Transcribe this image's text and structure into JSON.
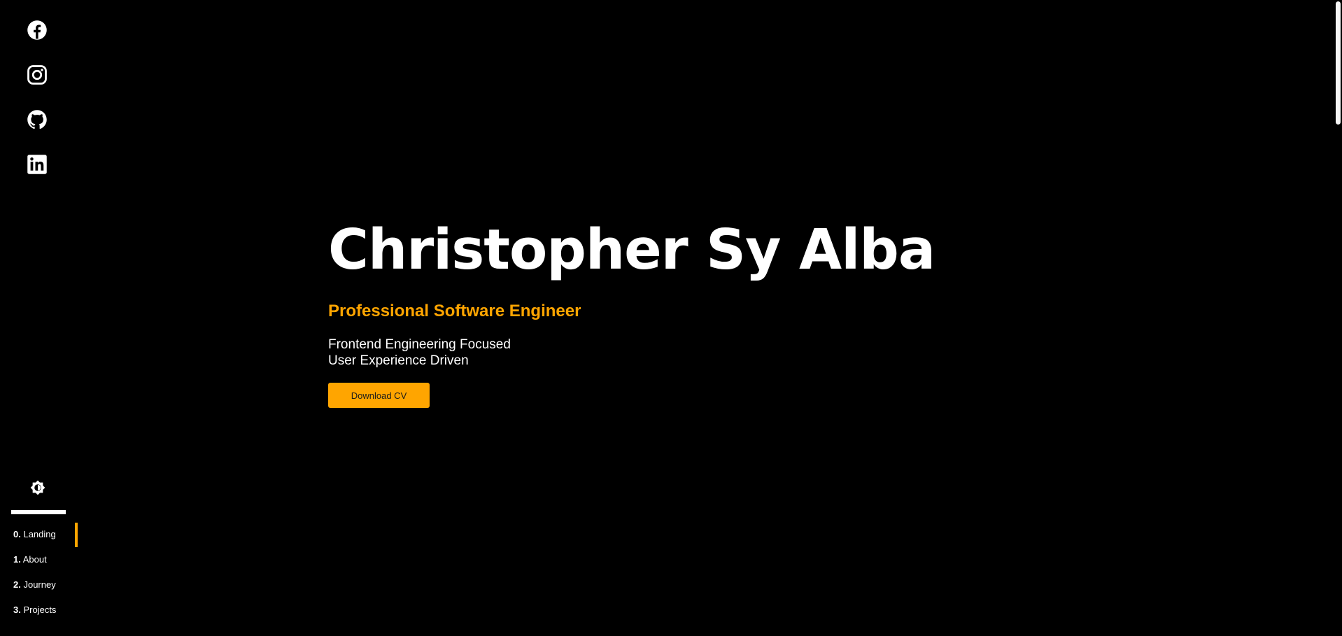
{
  "hero": {
    "name": "Christopher Sy Alba",
    "title": "Professional Software Engineer",
    "tagline_line1": "Frontend Engineering Focused",
    "tagline_line2": "User Experience Driven",
    "cv_button_label": "Download CV"
  },
  "social": {
    "icons": [
      "facebook-icon",
      "instagram-icon",
      "github-icon",
      "linkedin-icon"
    ]
  },
  "theme_toggle": {
    "icon": "brightness-icon"
  },
  "nav": {
    "items": [
      {
        "num": "0.",
        "label": "Landing"
      },
      {
        "num": "1.",
        "label": "About"
      },
      {
        "num": "2.",
        "label": "Journey"
      },
      {
        "num": "3.",
        "label": "Projects"
      }
    ],
    "active_index": 0
  },
  "colors": {
    "background": "#000000",
    "accent": "#FFA500",
    "text": "#FFFFFF"
  }
}
